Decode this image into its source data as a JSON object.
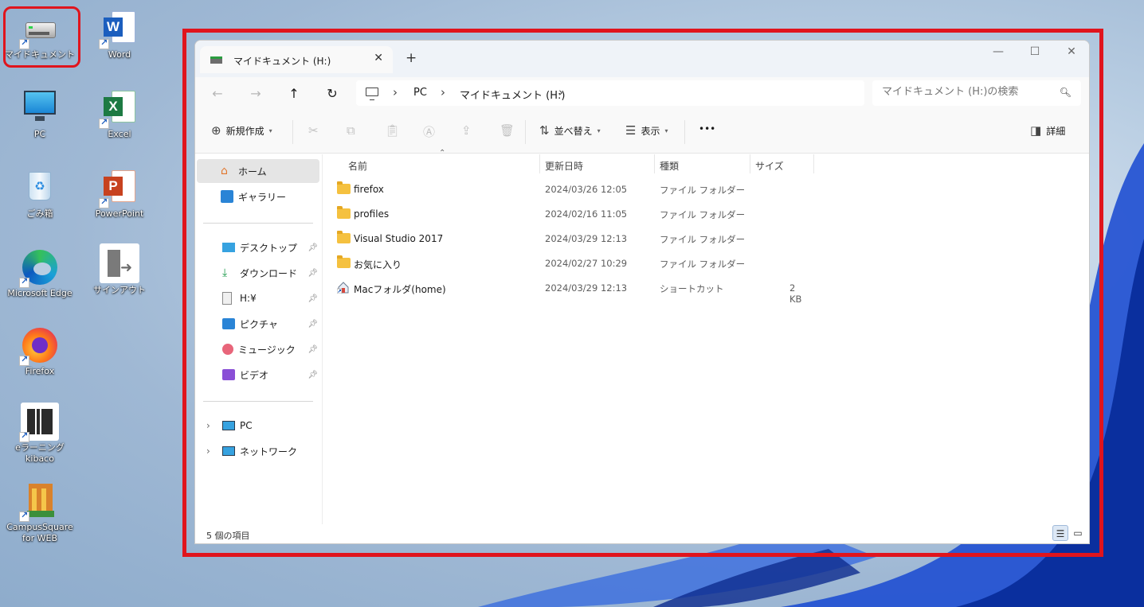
{
  "desktop": {
    "icons": [
      {
        "label": "マイドキュメント",
        "icon": "drive-icon"
      },
      {
        "label": "Word",
        "icon": "word-icon"
      },
      {
        "label": "PC",
        "icon": "monitor-icon"
      },
      {
        "label": "Excel",
        "icon": "excel-icon"
      },
      {
        "label": "ごみ箱",
        "icon": "recycle-bin-icon"
      },
      {
        "label": "PowerPoint",
        "icon": "powerpoint-icon"
      },
      {
        "label": "Microsoft Edge",
        "icon": "edge-icon"
      },
      {
        "label": "サインアウト",
        "icon": "sign-out-icon"
      },
      {
        "label": "Firefox",
        "icon": "firefox-icon"
      },
      {
        "label": "eラーニングkibaco",
        "icon": "kibaco-icon"
      },
      {
        "label": "CampusSquare for WEB",
        "icon": "campussquare-icon"
      }
    ]
  },
  "window": {
    "tab_title": "マイドキュメント (H:)",
    "close_tab": "✕",
    "new_tab": "+",
    "controls": {
      "minimize": "—",
      "maximize": "☐",
      "close": "✕"
    }
  },
  "nav": {
    "back": "←",
    "forward": "→",
    "up": "↑",
    "refresh": "↻",
    "breadcrumb": [
      "PC",
      "マイドキュメント (H:)"
    ],
    "search_placeholder": "マイドキュメント (H:)の検索"
  },
  "commands": {
    "new": "新規作成",
    "sort": "並べ替え",
    "view": "表示",
    "more": "•••",
    "details": "詳細"
  },
  "sidebar": {
    "home": "ホーム",
    "gallery": "ギャラリー",
    "quick": [
      {
        "label": "デスクトップ",
        "icon": "desktop-icon"
      },
      {
        "label": "ダウンロード",
        "icon": "download-icon"
      },
      {
        "label": "H:¥",
        "icon": "document-icon"
      },
      {
        "label": "ピクチャ",
        "icon": "pictures-icon"
      },
      {
        "label": "ミュージック",
        "icon": "music-icon"
      },
      {
        "label": "ビデオ",
        "icon": "video-icon"
      }
    ],
    "pc": "PC",
    "network": "ネットワーク"
  },
  "columns": {
    "name": "名前",
    "date": "更新日時",
    "type": "種類",
    "size": "サイズ"
  },
  "files": [
    {
      "name": "firefox",
      "date": "2024/03/26 12:05",
      "type": "ファイル フォルダー",
      "size": "",
      "kind": "folder"
    },
    {
      "name": "profiles",
      "date": "2024/02/16 11:05",
      "type": "ファイル フォルダー",
      "size": "",
      "kind": "folder"
    },
    {
      "name": "Visual Studio 2017",
      "date": "2024/03/29 12:13",
      "type": "ファイル フォルダー",
      "size": "",
      "kind": "folder"
    },
    {
      "name": "お気に入り",
      "date": "2024/02/27 10:29",
      "type": "ファイル フォルダー",
      "size": "",
      "kind": "folder"
    },
    {
      "name": "Macフォルダ(home)",
      "date": "2024/03/29 12:13",
      "type": "ショートカット",
      "size": "2 KB",
      "kind": "shortcut"
    }
  ],
  "status": {
    "count": "5 個の項目"
  },
  "colors": {
    "highlight": "#e0141d",
    "folder": "#f5c13f",
    "accent": "#0067c0"
  }
}
